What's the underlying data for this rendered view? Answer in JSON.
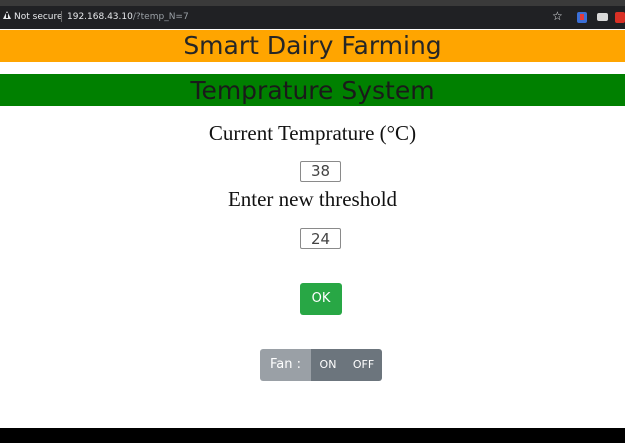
{
  "browser": {
    "security_label": "Not secure",
    "url_host": "192.168.43.10",
    "url_path": "/?temp_N=7",
    "icons": [
      "warning-icon",
      "star-icon",
      "extension-icon",
      "extension-icon",
      "extension-icon"
    ]
  },
  "header": {
    "title": "Smart Dairy Farming",
    "subtitle": "Temprature System"
  },
  "temperature": {
    "label": "Current Temprature (°C)",
    "value": "38"
  },
  "threshold": {
    "label": "Enter new threshold",
    "value": "24"
  },
  "ok_button": {
    "label": "OK"
  },
  "fan": {
    "label": "Fan :",
    "on_label": "ON",
    "off_label": "OFF"
  },
  "colors": {
    "banner_orange": "#ffa500",
    "banner_green": "#008000",
    "ok_green": "#28a745",
    "fan_gray": "#6c757d"
  }
}
